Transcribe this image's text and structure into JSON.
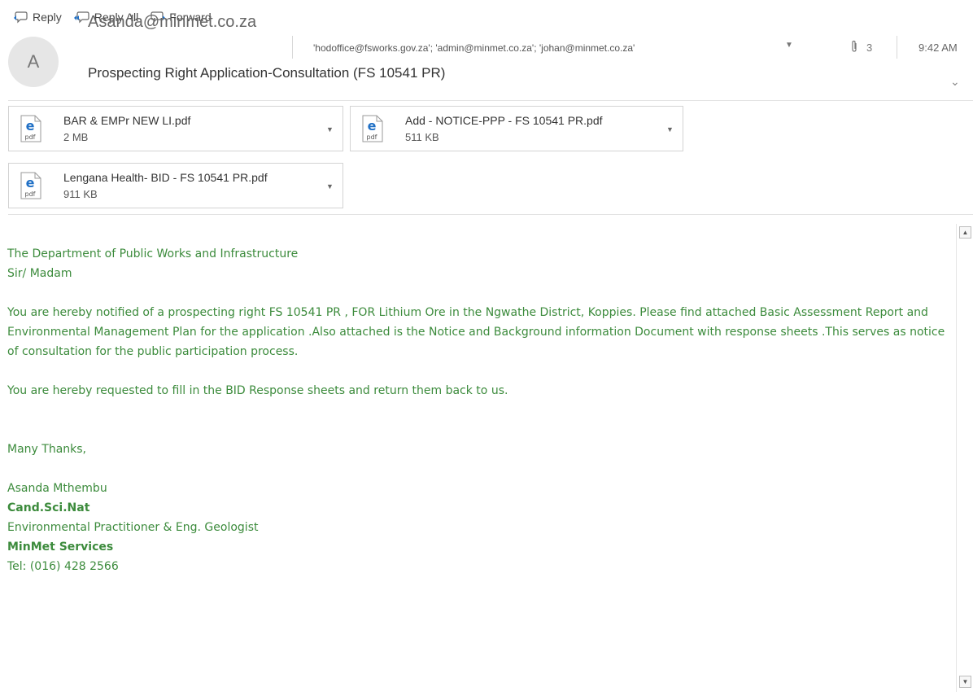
{
  "toolbar": {
    "reply_label": "Reply",
    "reply_all_label": "Reply All",
    "forward_label": "Forward"
  },
  "message": {
    "avatar_initial": "A",
    "sender": "Asanda@minmet.co.za",
    "recipients": "'hodoffice@fsworks.gov.za'; 'admin@minmet.co.za'; 'johan@minmet.co.za'",
    "attachment_count": "3",
    "time": "9:42 AM",
    "subject": "Prospecting Right Application-Consultation (FS 10541 PR)"
  },
  "attachments": [
    {
      "name": "BAR & EMPr NEW LI.pdf",
      "size": "2 MB",
      "icon_label": "pdf"
    },
    {
      "name": "Add - NOTICE-PPP - FS 10541 PR.pdf",
      "size": "511 KB",
      "icon_label": "pdf"
    },
    {
      "name": "Lengana Health- BID  - FS 10541 PR.pdf",
      "size": "911 KB",
      "icon_label": "pdf"
    }
  ],
  "body": {
    "line1": "The Department of Public Works and Infrastructure",
    "line2": "Sir/ Madam",
    "para1": "You are hereby notified of a prospecting right FS 10541 PR , FOR Lithium Ore in the Ngwathe District, Koppies. Please find attached Basic Assessment Report and Environmental Management Plan for the application .Also attached is the Notice and Background information Document with response sheets .This serves as notice of consultation for the public participation process.",
    "para2": "You are hereby requested to fill in the BID Response sheets and return them back to us.",
    "closing": "Many Thanks,",
    "sig_name": "Asanda Mthembu",
    "sig_title": "Cand.Sci.Nat",
    "sig_role": "Environmental Practitioner & Eng. Geologist",
    "sig_company": "MinMet Services",
    "sig_tel": "Tel: (016) 428 2566"
  },
  "colors": {
    "body_text": "#3c8b3c",
    "icon_blue": "#1f6fc5"
  }
}
